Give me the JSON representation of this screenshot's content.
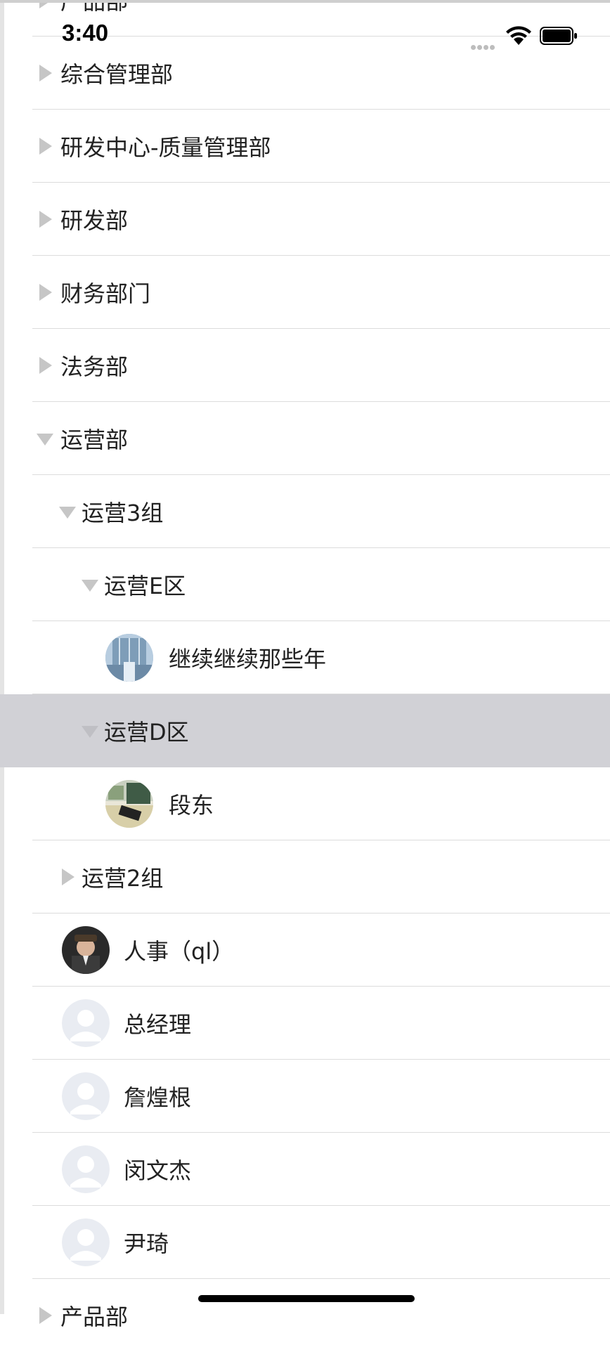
{
  "status": {
    "time": "3:40"
  },
  "tree": {
    "top_partial": "产品部",
    "rows": [
      {
        "label": "综合管理部"
      },
      {
        "label": "研发中心-质量管理部"
      },
      {
        "label": "研发部"
      },
      {
        "label": "财务部门"
      },
      {
        "label": "法务部"
      },
      {
        "label": "运营部"
      },
      {
        "label": "运营3组"
      },
      {
        "label": "运营E区"
      },
      {
        "label": "继续继续那些年"
      },
      {
        "label": "运营D区"
      },
      {
        "label": "段东"
      },
      {
        "label": "运营2组"
      },
      {
        "label": "人事（ql）"
      },
      {
        "label": "总经理"
      },
      {
        "label": "詹煌根"
      },
      {
        "label": "闵文杰"
      },
      {
        "label": "尹琦"
      }
    ],
    "bottom_partial": "产品部"
  },
  "colors": {
    "selected_row": "#d1d1d6",
    "triangle": "#c6c6c6",
    "separator": "#dcdcdc"
  }
}
